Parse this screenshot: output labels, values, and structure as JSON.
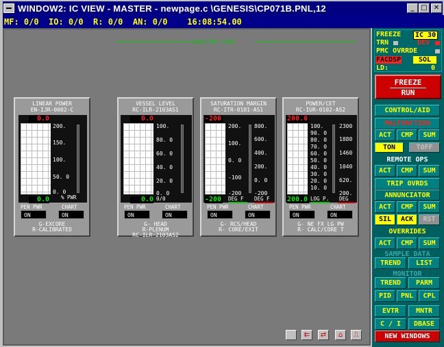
{
  "window": {
    "title": "WINDOW2:  IC VIEW - MASTER - newpage.c \\GENESIS\\CP071B.PNL,12",
    "min_icon": "minimize-icon",
    "max_icon": "maximize-icon",
    "close_icon": "close-icon"
  },
  "status": {
    "text": "MF: 0/0  IO: 0/0  R: 0/0  AN: 0/0    16:08:54.00"
  },
  "section_title": "REACTOR CORE",
  "panels": [
    {
      "title1": "LINEAR POWER",
      "title2": "EN-IJR-0002-C",
      "digital_top": "0.0",
      "digital_bottom": "0.0",
      "scale": [
        "200.",
        "150.",
        "100.",
        "50. 0",
        "0. 0"
      ],
      "unit": "% PWR",
      "pen_label": "PEN PWR",
      "chart_label": "CHART",
      "pen_value": "ON",
      "chart_value": "ON",
      "foot1": "G-EXCORE",
      "foot2": "R-CALIBRATED",
      "foot3": ""
    },
    {
      "title1": "VESSEL LEVEL",
      "title2": "RC-ILR-2103AS1",
      "digital_top": "0.0",
      "digital_bottom": "0.0",
      "scale": [
        "100.",
        "80. 0",
        "60. 0",
        "40. 0",
        "20. 0",
        "0. 0"
      ],
      "unit": "0/0",
      "pen_label": "PEN PWR",
      "chart_label": "CHART",
      "pen_value": "ON",
      "chart_value": "ON",
      "foot1": "G- HEAD",
      "foot2": "R-PLENUM",
      "foot3": "RC-ILR-2103AS2"
    },
    {
      "title1": "SATURATION MARGIN",
      "title2": "RC-ITR-0101-AS1",
      "digital_top": "-200",
      "digital_bottom": "-200",
      "scale": [
        "200.",
        "100.",
        "0. 0",
        "-100",
        "-200"
      ],
      "scale2": [
        "800.",
        "600.",
        "400.",
        "200.",
        "0. 0",
        "-200"
      ],
      "unit": "DEG F",
      "unit2": "DEG F",
      "pen_label": "PEN PWR",
      "chart_label": "CHART",
      "pen_value": "ON",
      "chart_value": "ON",
      "foot1": "G- RCS/HEAD",
      "foot2": "R- CORE/EXIT",
      "foot3": ""
    },
    {
      "title1": "POWER/CET",
      "title2": "RC-IUR-0102-AS2",
      "digital_top": "200.0",
      "digital_bottom": "200.0",
      "scale": [
        "100.",
        "90. 0",
        "80. 0",
        "70. 0",
        "60. 0",
        "50. 0",
        "40. 0",
        "30. 0",
        "20. 0",
        "10. 0"
      ],
      "scale2": [
        "2300",
        "1880",
        "1460",
        "1040",
        "620.",
        "200."
      ],
      "unit": "LOG P.",
      "unit2": "DEG",
      "pen_label": "PEN PWR",
      "chart_label": "CHART",
      "pen_value": "ON",
      "chart_value": "ON",
      "foot1": "G- NE FX LG PW",
      "foot2": "R- CALC/CORE T",
      "foot3": ""
    }
  ],
  "right_panel": {
    "freeze_label": "FREEZE",
    "ic_label": "IC 30",
    "trn_label": "TRN",
    "dev_label": "DEV",
    "pmc_label": "PMC OVRRDE",
    "facdsp_label": "FACDSP",
    "sol_label": "SOL",
    "ld_label": "LD:",
    "ld_value": "0",
    "freeze_run_top": "FREEZE",
    "freeze_run_bottom": "RUN",
    "control_aid": "CONTROL/AID",
    "malfunction": "MALFUNCTION",
    "act": "ACT",
    "cmp": "CMP",
    "sum": "SUM",
    "ton": "TON",
    "toff": "TOFF",
    "remote_ops": "REMOTE OPS",
    "trip_ovrds": "TRIP OVRDS",
    "annunciator": "ANNUNCIATOR",
    "sil": "SIL",
    "ack": "ACK",
    "rst": "RST",
    "overrides": "OVERRIDES",
    "sample_data": "SAMPLE DATA",
    "trend": "TREND",
    "list": "LIST",
    "monitor": "MONITOR",
    "parm": "PARM",
    "pid": "PID",
    "pnl": "PNL",
    "cpl": "CPL",
    "evtr": "EVTR",
    "mntr": "MNTR",
    "ci": "C / I",
    "dbase": "DBASE",
    "new_windows": "NEW WINDOWS"
  },
  "colors": {
    "accent_yellow": "#ffff00",
    "panel_teal": "#008080",
    "alarm_red": "#cc0000",
    "trace_green": "#00cc00"
  }
}
